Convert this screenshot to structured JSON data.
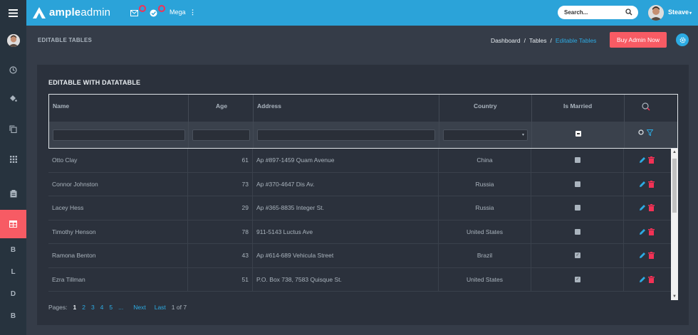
{
  "brand": {
    "bold": "ample",
    "light": "admin"
  },
  "topbar": {
    "mega_label": "Mega",
    "search_placeholder": "Search...",
    "user_name": "Steave"
  },
  "sidebar": {
    "letters": [
      "B",
      "L",
      "D",
      "B"
    ]
  },
  "page": {
    "title": "EDITABLE TABLES",
    "breadcrumb": [
      "Dashboard",
      "Tables",
      "Editable Tables"
    ],
    "buy_button": "Buy Admin Now"
  },
  "card": {
    "title": "EDITABLE WITH DATATABLE",
    "columns": [
      "Name",
      "Age",
      "Address",
      "Country",
      "Is Married"
    ],
    "rows": [
      {
        "name": "Otto Clay",
        "age": "61",
        "address": "Ap #897-1459 Quam Avenue",
        "country": "China",
        "married": false
      },
      {
        "name": "Connor Johnston",
        "age": "73",
        "address": "Ap #370-4647 Dis Av.",
        "country": "Russia",
        "married": false
      },
      {
        "name": "Lacey Hess",
        "age": "29",
        "address": "Ap #365-8835 Integer St.",
        "country": "Russia",
        "married": false
      },
      {
        "name": "Timothy Henson",
        "age": "78",
        "address": "911-5143 Luctus Ave",
        "country": "United States",
        "married": false
      },
      {
        "name": "Ramona Benton",
        "age": "43",
        "address": "Ap #614-689 Vehicula Street",
        "country": "Brazil",
        "married": true
      },
      {
        "name": "Ezra Tillman",
        "age": "51",
        "address": "P.O. Box 738, 7583 Quisque St.",
        "country": "United States",
        "married": true
      }
    ]
  },
  "pager": {
    "label": "Pages:",
    "pages": [
      "1",
      "2",
      "3",
      "4",
      "5"
    ],
    "dots": "...",
    "next": "Next",
    "last": "Last",
    "summary": "1 of 7"
  },
  "colors": {
    "topbar": "#2ba3d9",
    "accent": "#f75b64",
    "link": "#2cabe3",
    "edit": "#2cabe3",
    "delete": "#f33155"
  }
}
